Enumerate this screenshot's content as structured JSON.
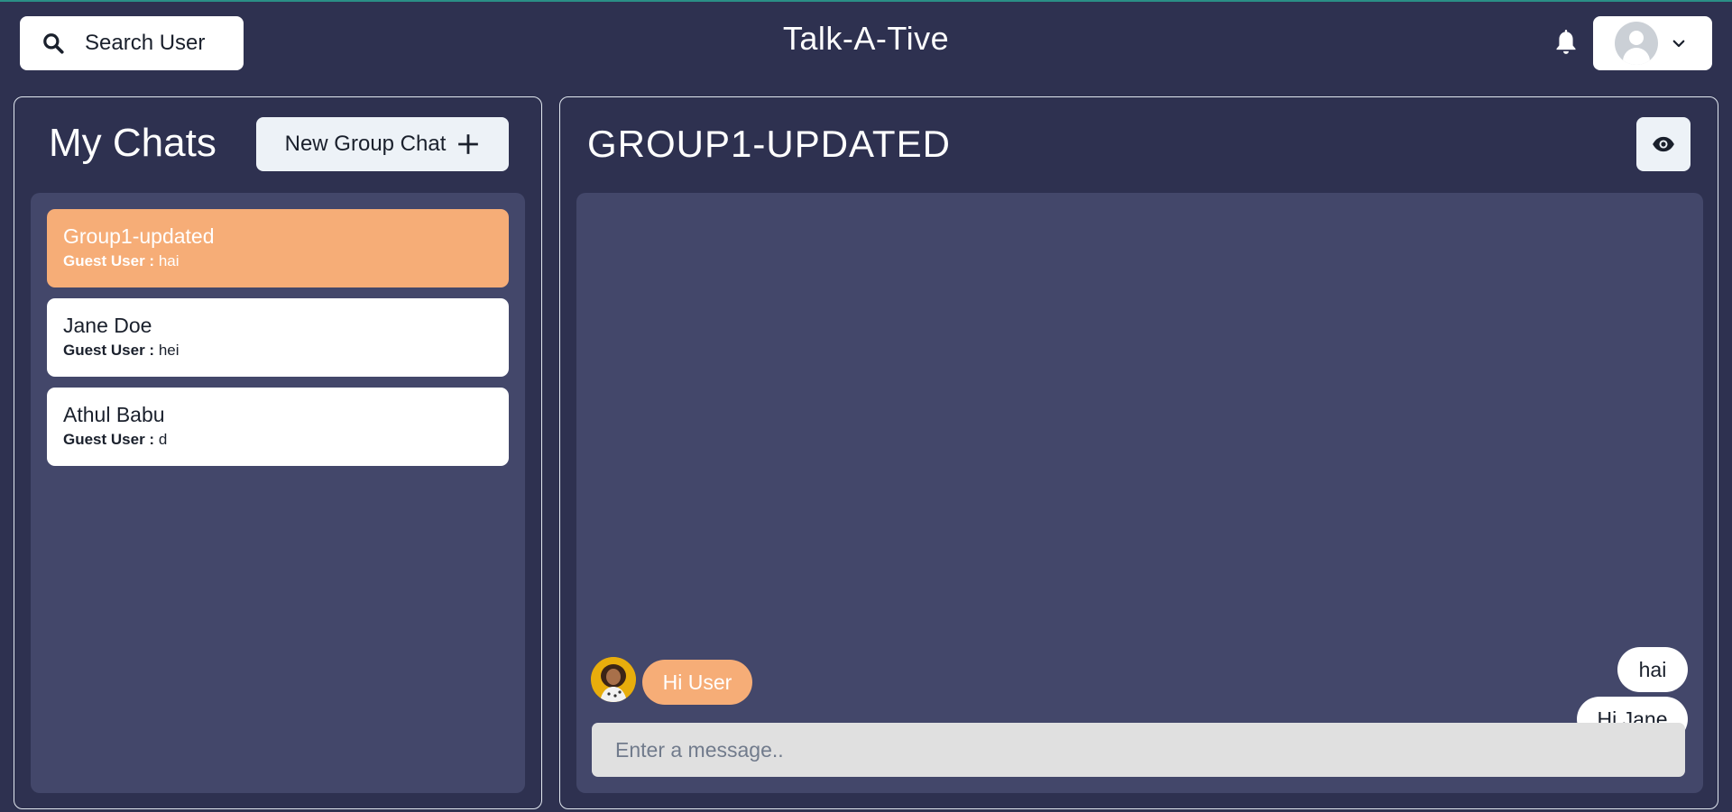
{
  "header": {
    "search_label": "Search User",
    "app_title": "Talk-A-Tive",
    "notification_icon": "bell-icon",
    "profile_icon": "default-avatar-icon",
    "menu_icon": "chevron-down-icon"
  },
  "sidebar": {
    "title": "My Chats",
    "new_group_label": "New Group Chat",
    "chats": [
      {
        "name": "Group1-updated",
        "sender": "Guest User :",
        "latest": "hai",
        "active": true
      },
      {
        "name": "Jane Doe",
        "sender": "Guest User :",
        "latest": "hei",
        "active": false
      },
      {
        "name": "Athul Babu",
        "sender": "Guest User :",
        "latest": "d",
        "active": false
      }
    ]
  },
  "chat": {
    "title": "GROUP1-UPDATED",
    "view_icon": "eye-icon",
    "messages": [
      {
        "text": "hai",
        "mine": true
      },
      {
        "text": "Hi Jane",
        "mine": true
      },
      {
        "text": "Hi User",
        "mine": false
      }
    ],
    "input_placeholder": "Enter a message.."
  },
  "colors": {
    "background": "#2e3150",
    "panel": "#43476a",
    "accent": "#f6ad77",
    "button": "#edf2f7"
  }
}
